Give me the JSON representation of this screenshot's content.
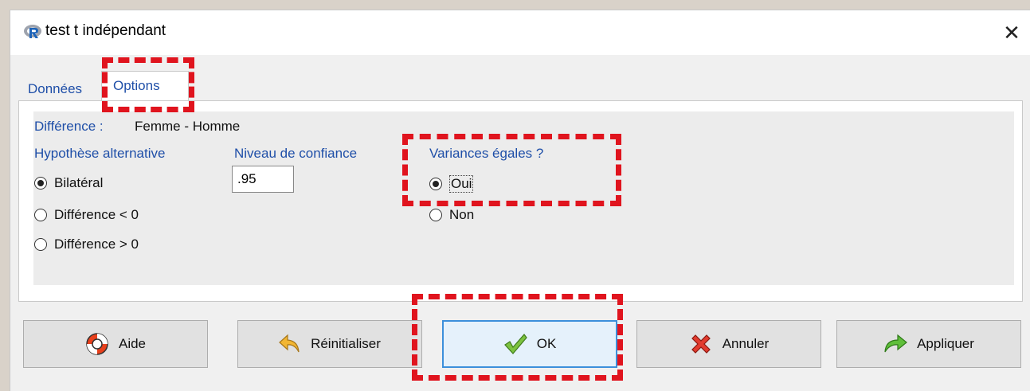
{
  "window": {
    "title": "test t indépendant",
    "app_icon": "r-logo-icon",
    "close_icon": "close-icon"
  },
  "tabs": [
    {
      "label": "Données",
      "active": false
    },
    {
      "label": "Options",
      "active": true
    }
  ],
  "difference": {
    "label": "Différence :",
    "value": "Femme - Homme"
  },
  "alternative": {
    "label": "Hypothèse alternative",
    "options": [
      {
        "label": "Bilatéral",
        "checked": true
      },
      {
        "label": "Différence < 0",
        "checked": false
      },
      {
        "label": "Différence > 0",
        "checked": false
      }
    ]
  },
  "confidence": {
    "label": "Niveau de confiance",
    "value": ".95"
  },
  "variances": {
    "label": "Variances égales ?",
    "options": [
      {
        "label": "Oui",
        "checked": true
      },
      {
        "label": "Non",
        "checked": false
      }
    ]
  },
  "buttons": [
    {
      "label": "Aide",
      "icon": "lifebuoy-icon"
    },
    {
      "label": "Réinitialiser",
      "icon": "undo-arrow-icon"
    },
    {
      "label": "OK",
      "icon": "checkmark-icon",
      "focused": true
    },
    {
      "label": "Annuler",
      "icon": "cancel-x-icon"
    },
    {
      "label": "Appliquer",
      "icon": "redo-arrow-icon"
    }
  ],
  "colors": {
    "annotation": "#e0141e",
    "label_blue": "#1f4fa8",
    "focus": "#3c8fdb"
  }
}
